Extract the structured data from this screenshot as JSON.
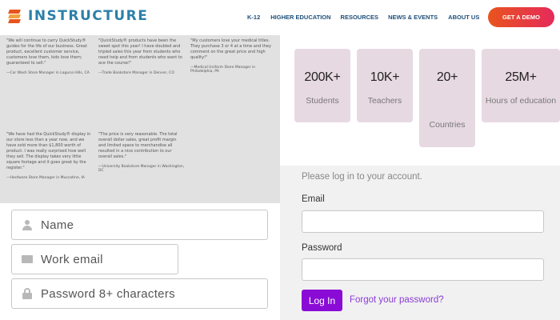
{
  "header": {
    "logo_text": "INSTRUCTURE",
    "nav": [
      "K-12",
      "HIGHER EDUCATION",
      "RESOURCES",
      "NEWS & EVENTS",
      "ABOUT US"
    ],
    "cta": "GET A DEMO"
  },
  "testimonials": [
    {
      "quote": "\"We will continue to carry QuickStudy® guides for the life of our business. Great product, excellent customer service, customers love them, kids love them; guaranteed to sell.\"",
      "author": "—Car Wash Store Manager in Laguna Hills, CA"
    },
    {
      "quote": "\"QuickStudy® products have been the sweet spot this year! I have doubled and tripled sales this year from students who need help and from students who want to ace the course!\"",
      "author": "—Trade Bookstore Manager in Denver, CO"
    },
    {
      "quote": "\"My customers love your medical titles. They purchase 3 or 4 at a time and they comment on the great price and high quality!\"",
      "author": "—Medical Uniform Store Manager in Philadelphia, PA"
    },
    {
      "quote": "\"We have had the QuickStudy® display in our store less than a year now, and we have sold more than $1,800 worth of product. I was really surprised how well they sell. The display takes very little square footage and it goes great by the register.\"",
      "author": "—Hardware Store Manager in Muscatine, IA"
    },
    {
      "quote": "\"The price is very reasonable. The total overall dollar sales, great profit margin and limited space to merchandise all resulted in a nice contribution to our overall sales.\"",
      "author": "—University Bookstore Manager in Washington, DC"
    }
  ],
  "signup": {
    "name_placeholder": "Name",
    "email_placeholder": "Work email",
    "password_placeholder": "Password 8+ characters"
  },
  "stats": [
    {
      "value": "200K+",
      "label": "Students"
    },
    {
      "value": "10K+",
      "label": "Teachers"
    },
    {
      "value": "20+",
      "label": "Countries"
    },
    {
      "value": "25M+",
      "label": "Hours of education"
    }
  ],
  "login": {
    "intro": "Please log in to your account.",
    "email_label": "Email",
    "password_label": "Password",
    "button": "Log In",
    "forgot": "Forgot your password?"
  },
  "colors": {
    "brand": "#2c80a8",
    "stat_card": "#e7d9e2",
    "login_button": "#8a0bd6",
    "cta_start": "#e8541e",
    "cta_end": "#e52a5a"
  }
}
